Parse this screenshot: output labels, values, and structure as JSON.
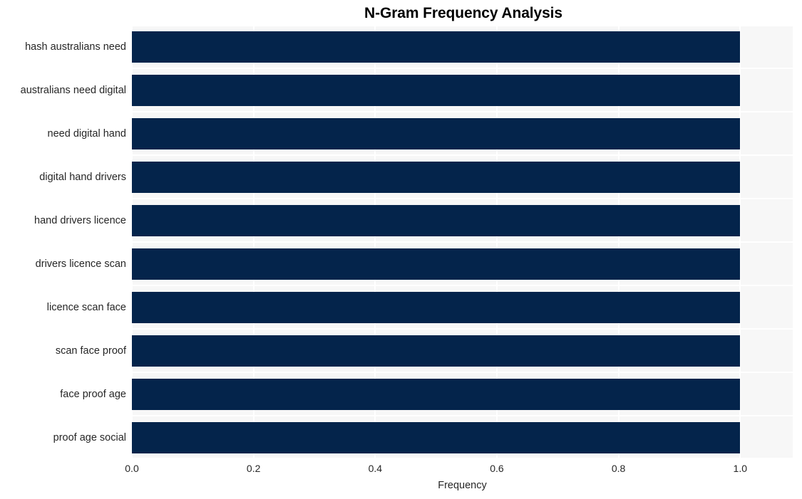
{
  "chart_data": {
    "type": "bar",
    "orientation": "horizontal",
    "title": "N-Gram Frequency Analysis",
    "xlabel": "Frequency",
    "ylabel": "",
    "categories": [
      "hash australians need",
      "australians need digital",
      "need digital hand",
      "digital hand drivers",
      "hand drivers licence",
      "drivers licence scan",
      "licence scan face",
      "scan face proof",
      "face proof age",
      "proof age social"
    ],
    "values": [
      1.0,
      1.0,
      1.0,
      1.0,
      1.0,
      1.0,
      1.0,
      1.0,
      1.0,
      1.0
    ],
    "xticks": [
      "0.0",
      "0.2",
      "0.4",
      "0.6",
      "0.8",
      "1.0"
    ],
    "xtick_values": [
      0.0,
      0.2,
      0.4,
      0.6,
      0.8,
      1.0
    ],
    "xlim": [
      0.0,
      1.0864
    ],
    "grid": true,
    "legend": null,
    "bar_color": "#04244b",
    "plot_background": "#f7f7f7",
    "grid_color": "#ffffff",
    "figure_background": "#ffffff",
    "text_color": "#262626"
  }
}
